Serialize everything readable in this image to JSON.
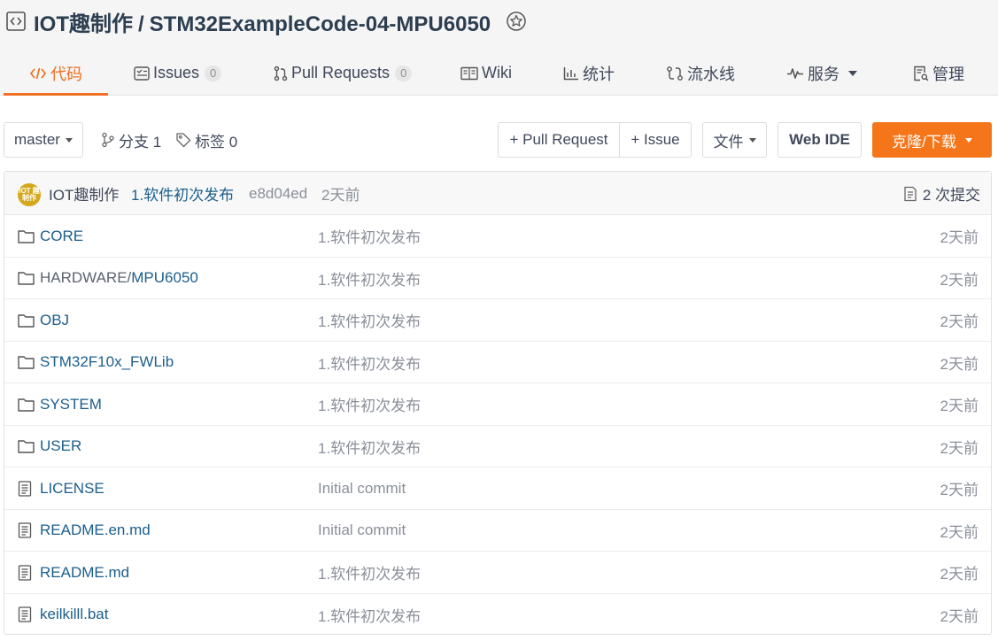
{
  "header": {
    "owner": "IOT趣制作",
    "separator": "/",
    "repo": "STM32ExampleCode-04-MPU6050"
  },
  "tabs": [
    {
      "label": "代码",
      "icon": "code-icon",
      "active": true
    },
    {
      "label": "Issues",
      "icon": "issues-icon",
      "count": "0"
    },
    {
      "label": "Pull Requests",
      "icon": "pull-request-icon",
      "count": "0"
    },
    {
      "label": "Wiki",
      "icon": "wiki-icon"
    },
    {
      "label": "统计",
      "icon": "stats-icon"
    },
    {
      "label": "流水线",
      "icon": "pipeline-icon"
    },
    {
      "label": "服务",
      "icon": "service-icon",
      "dropdown": true
    },
    {
      "label": "管理",
      "icon": "manage-icon"
    }
  ],
  "toolbar": {
    "branch": "master",
    "branches_label": "分支 1",
    "tags_label": "标签 0",
    "pull_request_label": "+ Pull Request",
    "issue_label": "+ Issue",
    "file_label": "文件",
    "webide_label": "Web IDE",
    "clone_label": "克隆/下载"
  },
  "commit": {
    "avatar_text": "IOT 趣制作",
    "author": "IOT趣制作",
    "message": "1.软件初次发布",
    "hash": "e8d04ed",
    "time": "2天前",
    "commits_label": "2 次提交"
  },
  "files": [
    {
      "type": "folder",
      "prefix": "",
      "name": "CORE",
      "message": "1.软件初次发布",
      "time": "2天前"
    },
    {
      "type": "folder",
      "prefix": "HARDWARE/",
      "name": "MPU6050",
      "message": "1.软件初次发布",
      "time": "2天前"
    },
    {
      "type": "folder",
      "prefix": "",
      "name": "OBJ",
      "message": "1.软件初次发布",
      "time": "2天前"
    },
    {
      "type": "folder",
      "prefix": "",
      "name": "STM32F10x_FWLib",
      "message": "1.软件初次发布",
      "time": "2天前"
    },
    {
      "type": "folder",
      "prefix": "",
      "name": "SYSTEM",
      "message": "1.软件初次发布",
      "time": "2天前"
    },
    {
      "type": "folder",
      "prefix": "",
      "name": "USER",
      "message": "1.软件初次发布",
      "time": "2天前"
    },
    {
      "type": "file",
      "prefix": "",
      "name": "LICENSE",
      "message": "Initial commit",
      "time": "2天前"
    },
    {
      "type": "file",
      "prefix": "",
      "name": "README.en.md",
      "message": "Initial commit",
      "time": "2天前"
    },
    {
      "type": "file",
      "prefix": "",
      "name": "README.md",
      "message": "1.软件初次发布",
      "time": "2天前"
    },
    {
      "type": "file",
      "prefix": "",
      "name": "keilkilll.bat",
      "message": "1.软件初次发布",
      "time": "2天前"
    }
  ],
  "colors": {
    "accent": "#f06f20",
    "clone_button": "#f5761a",
    "link": "#1b5e8c",
    "muted": "#8a8f99"
  }
}
